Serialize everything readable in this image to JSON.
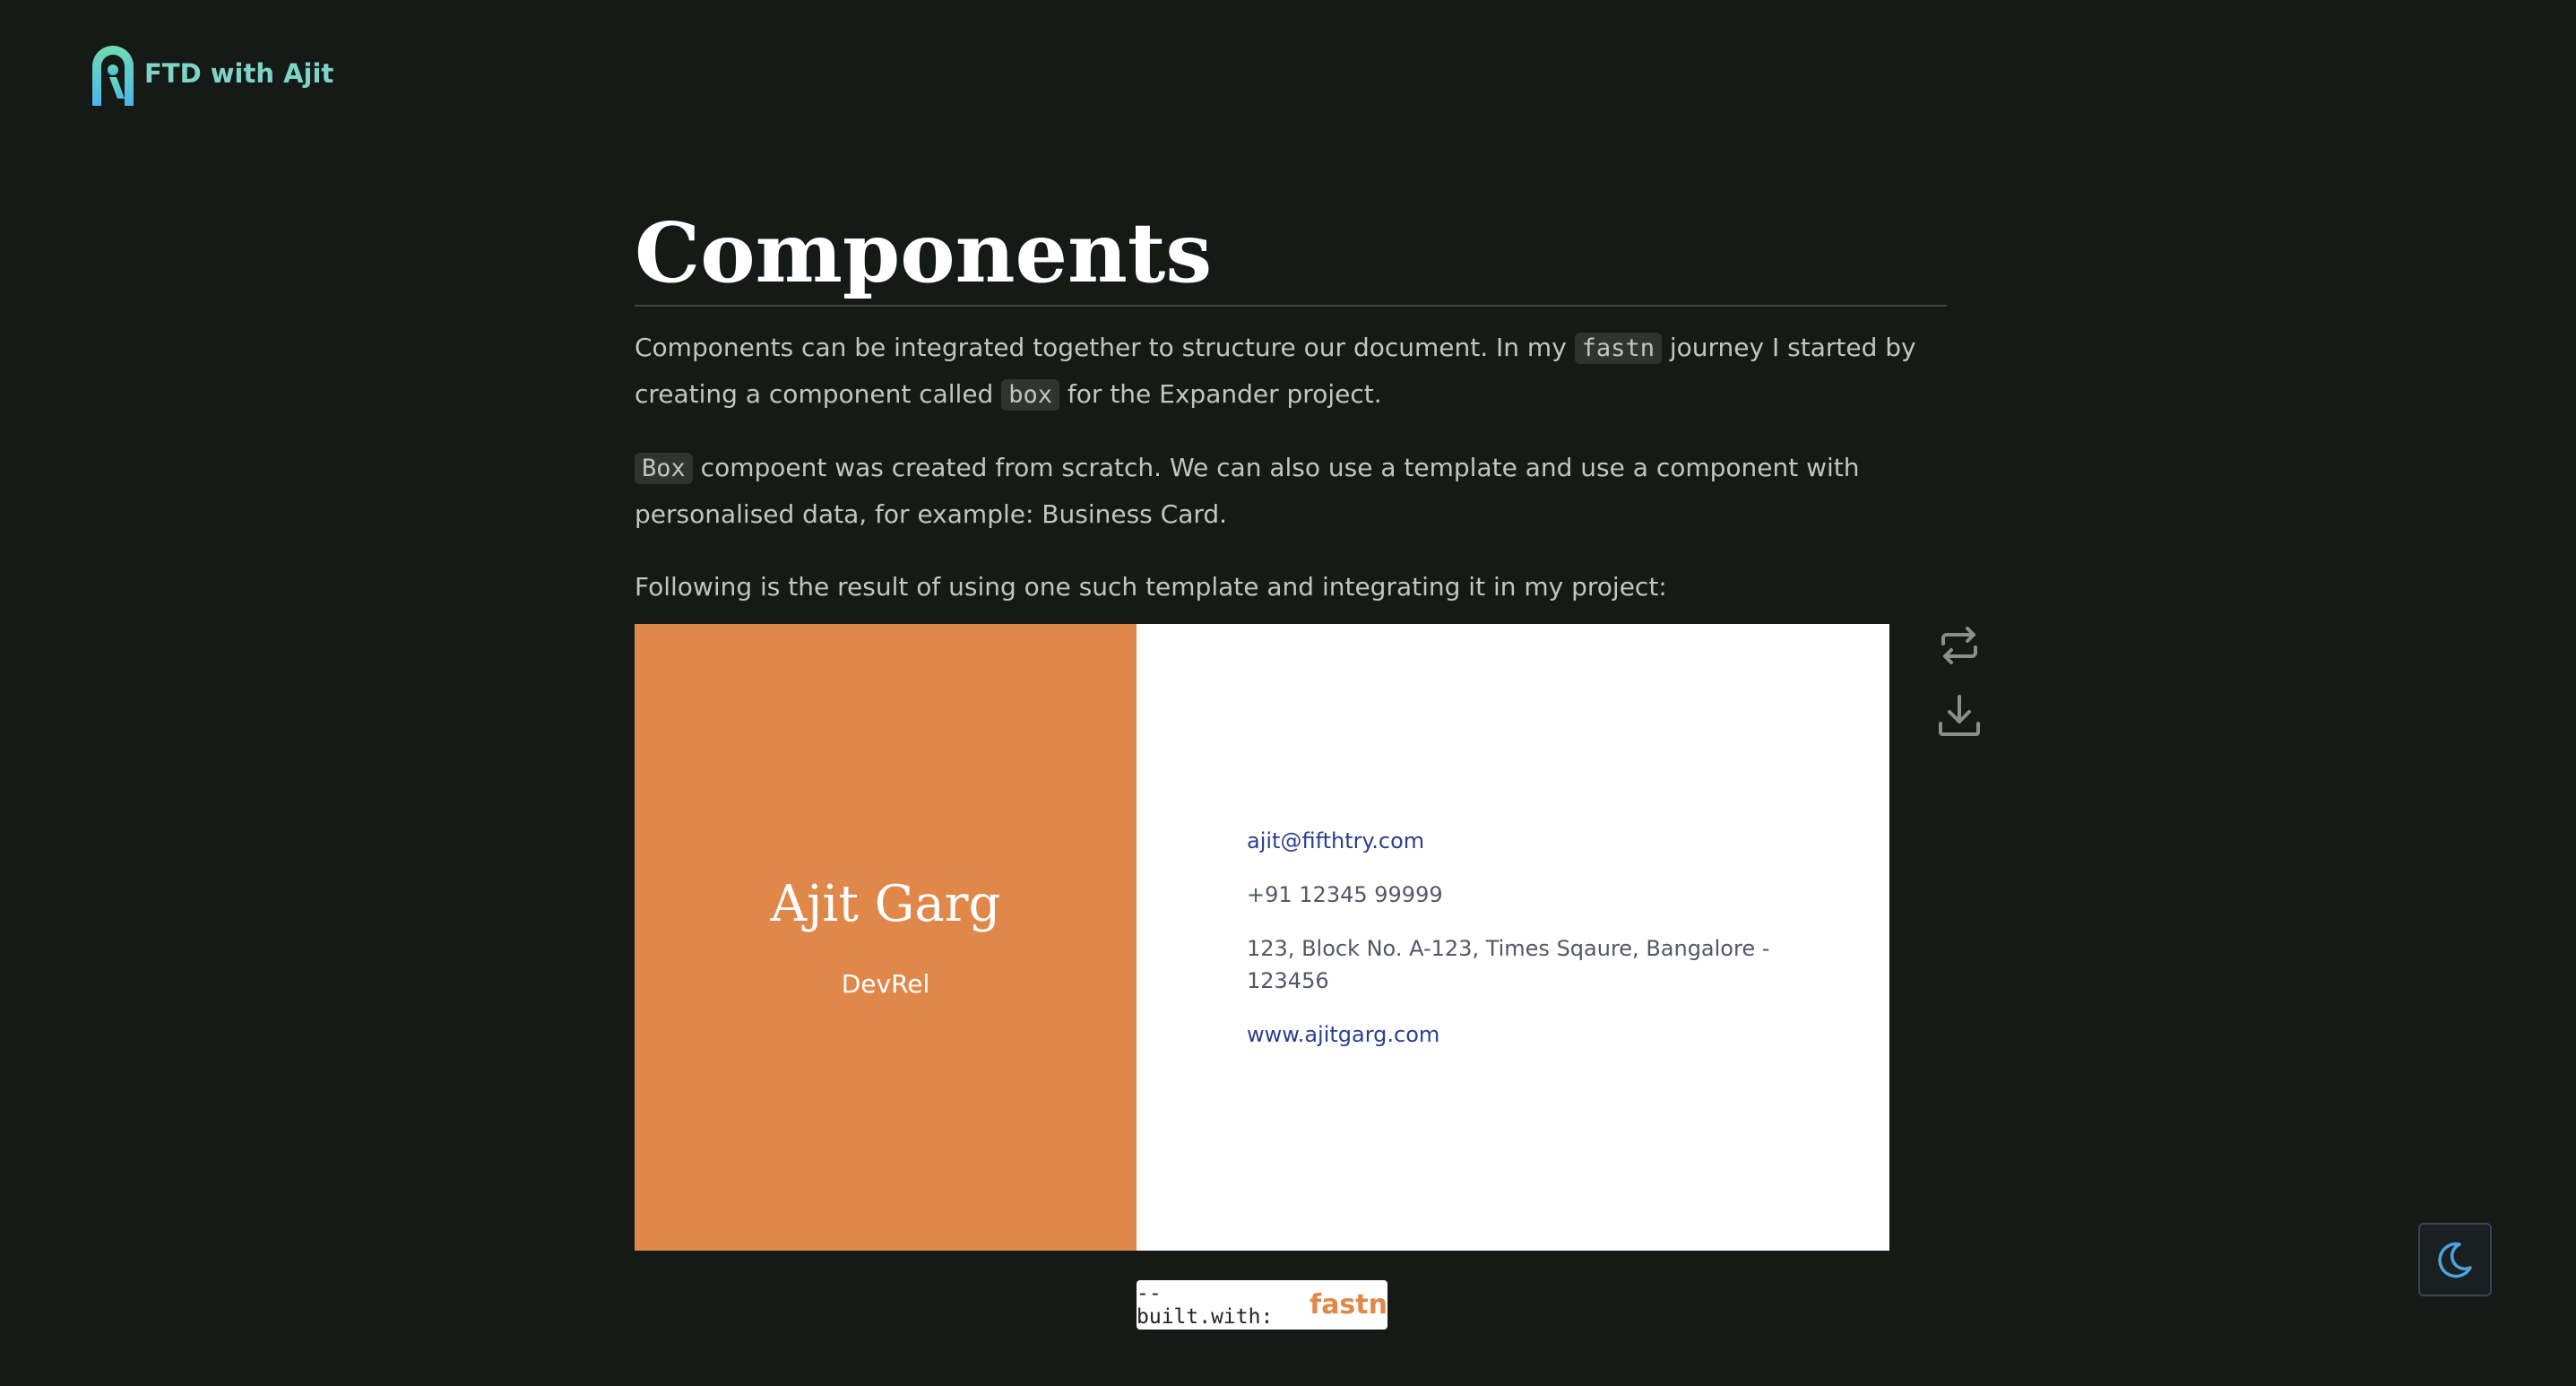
{
  "header": {
    "logo_text": "FTD with Ajit"
  },
  "main": {
    "title": "Components",
    "para1": {
      "t1": "Components can be integrated together to structure our document. In my ",
      "code1": "fastn",
      "t2": " journey I started by creating a component called ",
      "code2": "box",
      "t3": " for the Expander project."
    },
    "para2": {
      "code1": "Box",
      "t1": " compoent was created from scratch. We can also use a template and use a component with personalised data, for example: Business Card."
    },
    "para3": "Following is the result of using one such template and integrating it in my project:"
  },
  "card": {
    "name": "Ajit Garg",
    "role": "DevRel",
    "email": "ajit@fifthtry.com",
    "phone": "+91 12345 99999",
    "address": "123, Block No. A-123, Times Sqaure, Bangalore - 123456",
    "website": "www.ajitgarg.com",
    "left_color": "#e0884a"
  },
  "tools": {
    "flip_icon": "flip-icon",
    "download_icon": "download-icon"
  },
  "footer": {
    "badge_prefix": "-- built.with:",
    "badge_brand": "fastn"
  },
  "theme_toggle": {
    "icon": "moon-icon"
  }
}
